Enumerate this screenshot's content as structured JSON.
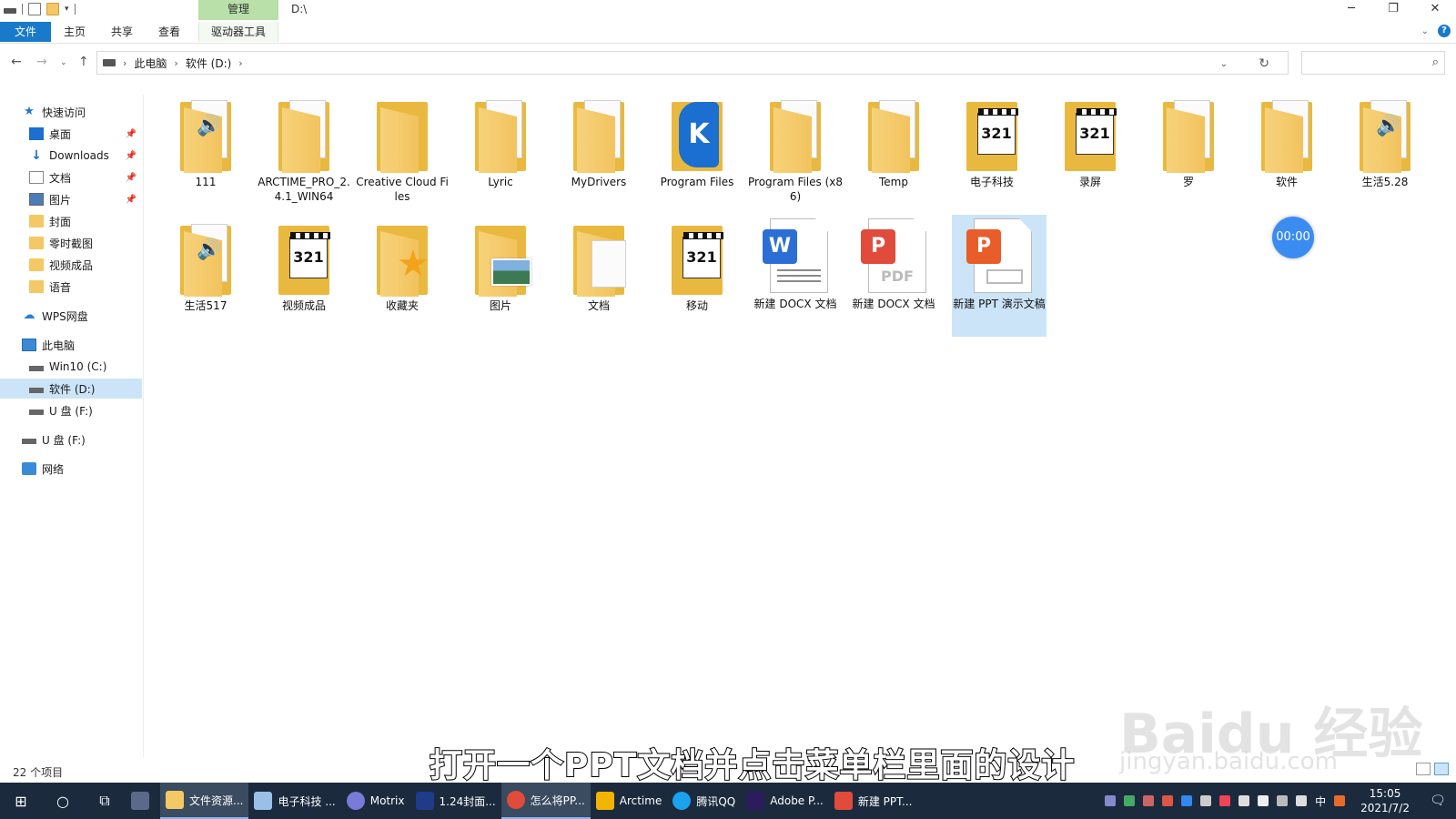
{
  "window": {
    "title_path": "D:\\",
    "manage_tab": "管理",
    "controls": [
      "─",
      "❐",
      "✕"
    ]
  },
  "ribbon": {
    "tabs": [
      "文件",
      "主页",
      "共享",
      "查看",
      "驱动器工具"
    ],
    "help": "?"
  },
  "address": {
    "crumbs": [
      "此电脑",
      "软件 (D:)"
    ],
    "search_placeholder": ""
  },
  "sidebar": {
    "items": [
      {
        "label": "快速访问",
        "icon": "star-icon"
      },
      {
        "label": "桌面",
        "icon": "desktop-icon"
      },
      {
        "label": "Downloads",
        "icon": "download-icon"
      },
      {
        "label": "文档",
        "icon": "document-icon"
      },
      {
        "label": "图片",
        "icon": "picture-icon"
      },
      {
        "label": "封面",
        "icon": "folder-icon"
      },
      {
        "label": "零时截图",
        "icon": "folder-icon"
      },
      {
        "label": "视频成品",
        "icon": "folder-icon"
      },
      {
        "label": "语音",
        "icon": "folder-icon"
      },
      {
        "label": "WPS网盘",
        "icon": "cloud-icon"
      },
      {
        "label": "此电脑",
        "icon": "computer-icon"
      },
      {
        "label": "Win10 (C:)",
        "icon": "drive-icon"
      },
      {
        "label": "软件 (D:)",
        "icon": "drive-icon"
      },
      {
        "label": "U 盘 (F:)",
        "icon": "drive-icon"
      },
      {
        "label": "U 盘 (F:)",
        "icon": "drive-icon"
      },
      {
        "label": "网络",
        "icon": "network-icon"
      }
    ]
  },
  "files": [
    {
      "name": "111",
      "type": "folder",
      "icon": "media-folder-icon"
    },
    {
      "name": "ARCTIME_PRO_2.4.1_WIN64",
      "type": "folder",
      "icon": "folder-icon"
    },
    {
      "name": "Creative Cloud Files",
      "type": "folder",
      "icon": "folder-icon"
    },
    {
      "name": "Lyric",
      "type": "folder",
      "icon": "folder-icon"
    },
    {
      "name": "MyDrivers",
      "type": "folder",
      "icon": "folder-icon"
    },
    {
      "name": "Program Files",
      "type": "folder",
      "icon": "kugou-folder-icon"
    },
    {
      "name": "Program Files (x86)",
      "type": "folder",
      "icon": "folder-icon"
    },
    {
      "name": "Temp",
      "type": "folder",
      "icon": "folder-icon"
    },
    {
      "name": "电子科技",
      "type": "folder",
      "icon": "video-folder-icon"
    },
    {
      "name": "录屏",
      "type": "folder",
      "icon": "video-folder-icon"
    },
    {
      "name": "罗",
      "type": "folder",
      "icon": "folder-icon"
    },
    {
      "name": "软件",
      "type": "folder",
      "icon": "folder-icon"
    },
    {
      "name": "生活5.28",
      "type": "folder",
      "icon": "media-folder-icon"
    },
    {
      "name": "生活517",
      "type": "folder",
      "icon": "media-folder-icon"
    },
    {
      "name": "视频成品",
      "type": "folder",
      "icon": "video-folder-icon"
    },
    {
      "name": "收藏夹",
      "type": "folder",
      "icon": "favorites-folder-icon"
    },
    {
      "name": "图片",
      "type": "folder",
      "icon": "pictures-folder-icon"
    },
    {
      "name": "文档",
      "type": "folder",
      "icon": "documents-folder-icon"
    },
    {
      "name": "移动",
      "type": "folder",
      "icon": "video-folder-icon"
    },
    {
      "name": "新建 DOCX 文档",
      "type": "docx",
      "icon": "word-file-icon",
      "badge": "W",
      "color": "#2b6fd6"
    },
    {
      "name": "新建 DOCX 文档",
      "type": "pdf",
      "icon": "pdf-file-icon",
      "badge": "P",
      "color": "#e04b3c"
    },
    {
      "name": "新建 PPT 演示文稿",
      "type": "ppt",
      "icon": "ppt-file-icon",
      "badge": "P",
      "color": "#e85d2a",
      "selected": true
    }
  ],
  "glyphs": {
    "clap": "321",
    "kugou": "K",
    "star": "★",
    "pdf": "PDF"
  },
  "timer": "00:00",
  "status": {
    "count": "22 个项目"
  },
  "subtitle": "打开一个PPT文档并点击菜单栏里面的设计",
  "watermark": {
    "line1": "Baidu 经验",
    "line2": "jingyan.baidu.com"
  },
  "taskbar": {
    "apps": [
      {
        "label": "",
        "color": "#5a6a88"
      },
      {
        "label": "文件资源...",
        "color": "#f4c864",
        "active": true
      },
      {
        "label": "电子科技 ...",
        "color": "#9ac0e8"
      },
      {
        "label": "Motrix",
        "color": "#7a7ad8"
      },
      {
        "label": "1.24封面...",
        "color": "#1f3b8a"
      },
      {
        "label": "怎么将PP...",
        "color": "#e24b3b",
        "active": true
      },
      {
        "label": "Arctime",
        "color": "#f3b400"
      },
      {
        "label": "腾讯QQ",
        "color": "#1aa2ee"
      },
      {
        "label": "Adobe P...",
        "color": "#2b1d5c"
      },
      {
        "label": "新建 PPT...",
        "color": "#e04b3c"
      }
    ],
    "tray_lang": "中",
    "time": "15:05",
    "date": "2021/7/2"
  }
}
